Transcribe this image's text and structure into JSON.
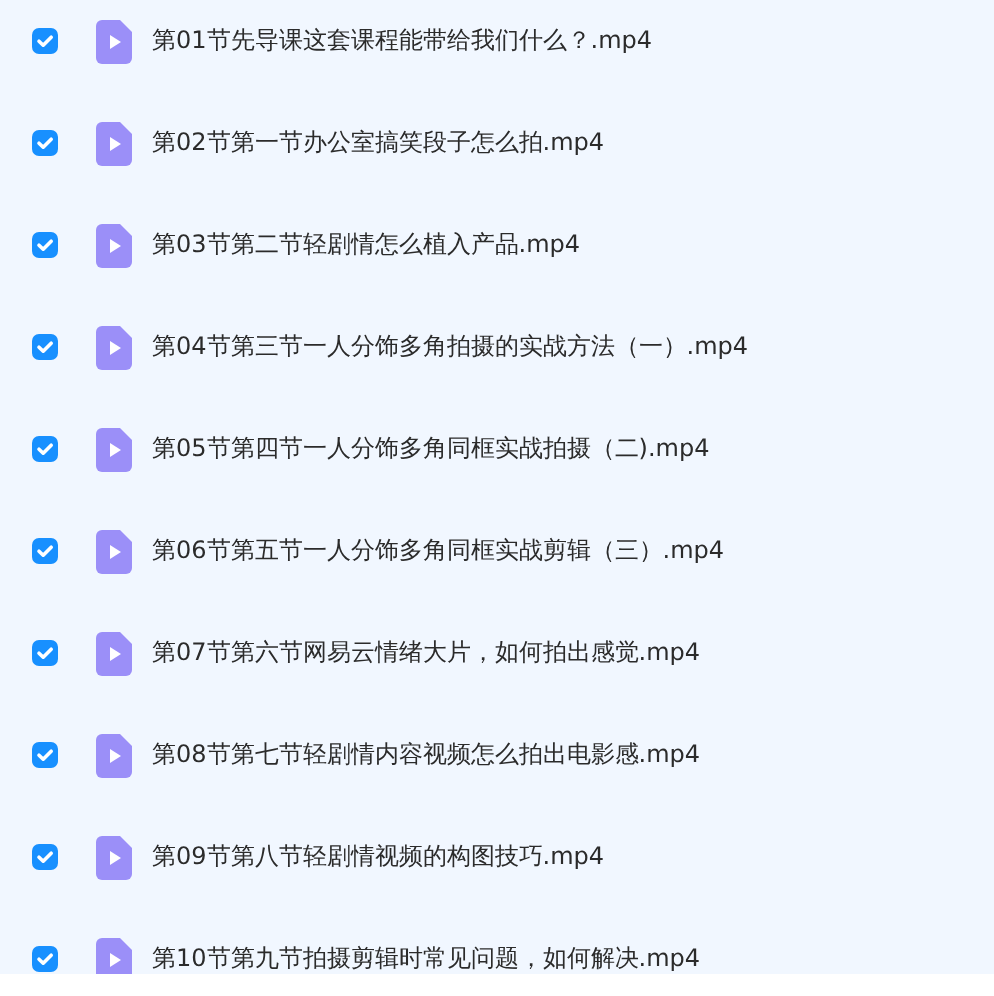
{
  "files": [
    {
      "name": "第01节先导课这套课程能带给我们什么？.mp4",
      "checked": true
    },
    {
      "name": "第02节第一节办公室搞笑段子怎么拍.mp4",
      "checked": true
    },
    {
      "name": "第03节第二节轻剧情怎么植入产品.mp4",
      "checked": true
    },
    {
      "name": "第04节第三节一人分饰多角拍摄的实战方法（一）.mp4",
      "checked": true
    },
    {
      "name": "第05节第四节一人分饰多角同框实战拍摄（二).mp4",
      "checked": true
    },
    {
      "name": "第06节第五节一人分饰多角同框实战剪辑（三）.mp4",
      "checked": true
    },
    {
      "name": "第07节第六节网易云情绪大片，如何拍出感觉.mp4",
      "checked": true
    },
    {
      "name": "第08节第七节轻剧情内容视频怎么拍出电影感.mp4",
      "checked": true
    },
    {
      "name": "第09节第八节轻剧情视频的构图技巧.mp4",
      "checked": true
    },
    {
      "name": "第10节第九节拍摄剪辑时常见问题，如何解决.mp4",
      "checked": true
    }
  ]
}
